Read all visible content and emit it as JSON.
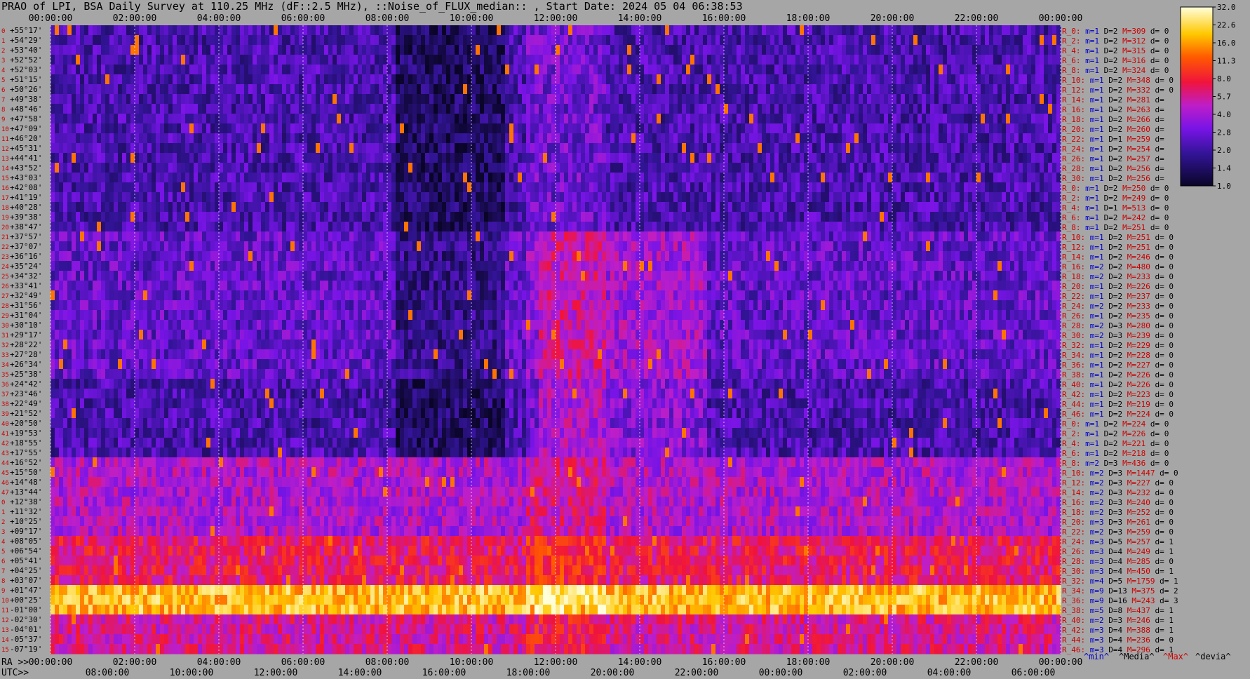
{
  "title": "PRAO of LPI, BSA Daily Survey at 110.25 MHz (dF::2.5 MHz), ::Noise_of_FLUX_median:: , Start Date: 2024 05 04 06:38:53",
  "chart_data": {
    "type": "heatmap",
    "title": "PRAO of LPI, BSA Daily Survey at 110.25 MHz (dF::2.5 MHz), ::Noise_of_FLUX_median:: , Start Date: 2024 05 04 06:38:53",
    "x_top_ticks": [
      "00:00:00",
      "02:00:00",
      "04:00:00",
      "06:00:00",
      "08:00:00",
      "10:00:00",
      "12:00:00",
      "14:00:00",
      "16:00:00",
      "18:00:00",
      "20:00:00",
      "22:00:00",
      "00:00:00"
    ],
    "ra_axis_label": "RA >>",
    "ra_ticks": [
      "00:00:00",
      "02:00:00",
      "04:00:00",
      "06:00:00",
      "08:00:00",
      "10:00:00",
      "12:00:00",
      "14:00:00",
      "16:00:00",
      "18:00:00",
      "20:00:00",
      "22:00:00",
      "00:00:00"
    ],
    "utc_axis_label": "UTC>>",
    "utc_ticks": [
      "08:00:00",
      "10:00:00",
      "12:00:00",
      "14:00:00",
      "16:00:00",
      "18:00:00",
      "20:00:00",
      "22:00:00",
      "00:00:00",
      "02:00:00",
      "04:00:00",
      "06:00:00"
    ],
    "declinations": [
      "+55°17'",
      "+54°29'",
      "+53°40'",
      "+52°52'",
      "+52°03'",
      "+51°15'",
      "+50°26'",
      "+49°38'",
      "+48°46'",
      "+47°58'",
      "+47°09'",
      "+46°20'",
      "+45°31'",
      "+44°41'",
      "+43°52'",
      "+43°03'",
      "+42°08'",
      "+41°19'",
      "+40°28'",
      "+39°38'",
      "+38°47'",
      "+37°57'",
      "+37°07'",
      "+36°16'",
      "+35°24'",
      "+34°32'",
      "+33°41'",
      "+32°49'",
      "+31°56'",
      "+31°04'",
      "+30°10'",
      "+29°17'",
      "+28°22'",
      "+27°28'",
      "+26°34'",
      "+25°38'",
      "+24°42'",
      "+23°46'",
      "+22°49'",
      "+21°52'",
      "+20°50'",
      "+19°53'",
      "+18°55'",
      "+17°55'",
      "+16°52'",
      "+15°50'",
      "+14°48'",
      "+13°44'",
      "+12°38'",
      "+11°32'",
      "+10°25'",
      "+09°17'",
      "+08°05'",
      "+06°54'",
      "+05°41'",
      "+04°25'",
      "+03°07'",
      "+01°47'",
      "+00°25'",
      "-01°00'",
      "-02°30'",
      "-04°01'",
      "-05°37'",
      "-07°19'"
    ],
    "row_stats": [
      [
        "R_0:",
        "m=1",
        "D=2",
        "M=309",
        "d= 0"
      ],
      [
        "R_2:",
        "m=1",
        "D=2",
        "M=312",
        "d= 0"
      ],
      [
        "R_4:",
        "m=1",
        "D=2",
        "M=315",
        "d= 0"
      ],
      [
        "R_6:",
        "m=1",
        "D=2",
        "M=316",
        "d= 0"
      ],
      [
        "R_8:",
        "m=1",
        "D=2",
        "M=324",
        "d= 0"
      ],
      [
        "R_10:",
        "m=1",
        "D=2",
        "M=348",
        "d= 0"
      ],
      [
        "R_12:",
        "m=1",
        "D=2",
        "M=332",
        "d= 0"
      ],
      [
        "R_14:",
        "m=1",
        "D=2",
        "M=281",
        "d= "
      ],
      [
        "R_16:",
        "m=1",
        "D=2",
        "M=263",
        "d= "
      ],
      [
        "R_18:",
        "m=1",
        "D=2",
        "M=266",
        "d= "
      ],
      [
        "R_20:",
        "m=1",
        "D=2",
        "M=260",
        "d= "
      ],
      [
        "R_22:",
        "m=1",
        "D=1",
        "M=259",
        "d= "
      ],
      [
        "R_24:",
        "m=1",
        "D=2",
        "M=254",
        "d= "
      ],
      [
        "R_26:",
        "m=1",
        "D=2",
        "M=257",
        "d= "
      ],
      [
        "R_28:",
        "m=1",
        "D=2",
        "M=256",
        "d= "
      ],
      [
        "R_30:",
        "m=1",
        "D=2",
        "M=256",
        "d= "
      ],
      [
        "R_0:",
        "m=1",
        "D=2",
        "M=250",
        "d= 0"
      ],
      [
        "R_2:",
        "m=1",
        "D=2",
        "M=249",
        "d= 0"
      ],
      [
        "R_4:",
        "m=1",
        "D=1",
        "M=513",
        "d= 0"
      ],
      [
        "R_6:",
        "m=1",
        "D=2",
        "M=242",
        "d= 0"
      ],
      [
        "R_8:",
        "m=1",
        "D=2",
        "M=251",
        "d= 0"
      ],
      [
        "R_10:",
        "m=1",
        "D=2",
        "M=251",
        "d= 0"
      ],
      [
        "R_12:",
        "m=1",
        "D=2",
        "M=251",
        "d= 0"
      ],
      [
        "R_14:",
        "m=1",
        "D=2",
        "M=246",
        "d= 0"
      ],
      [
        "R_16:",
        "m=2",
        "D=2",
        "M=480",
        "d= 0"
      ],
      [
        "R_18:",
        "m=2",
        "D=2",
        "M=233",
        "d= 0"
      ],
      [
        "R_20:",
        "m=1",
        "D=2",
        "M=226",
        "d= 0"
      ],
      [
        "R_22:",
        "m=1",
        "D=2",
        "M=237",
        "d= 0"
      ],
      [
        "R_24:",
        "m=2",
        "D=2",
        "M=233",
        "d= 0"
      ],
      [
        "R_26:",
        "m=1",
        "D=2",
        "M=235",
        "d= 0"
      ],
      [
        "R_28:",
        "m=2",
        "D=3",
        "M=280",
        "d= 0"
      ],
      [
        "R_30:",
        "m=2",
        "D=3",
        "M=239",
        "d= 0"
      ],
      [
        "R_32:",
        "m=1",
        "D=2",
        "M=229",
        "d= 0"
      ],
      [
        "R_34:",
        "m=1",
        "D=2",
        "M=228",
        "d= 0"
      ],
      [
        "R_36:",
        "m=1",
        "D=2",
        "M=227",
        "d= 0"
      ],
      [
        "R_38:",
        "m=1",
        "D=2",
        "M=226",
        "d= 0"
      ],
      [
        "R_40:",
        "m=1",
        "D=2",
        "M=226",
        "d= 0"
      ],
      [
        "R_42:",
        "m=1",
        "D=2",
        "M=223",
        "d= 0"
      ],
      [
        "R_44:",
        "m=1",
        "D=2",
        "M=219",
        "d= 0"
      ],
      [
        "R_46:",
        "m=1",
        "D=2",
        "M=224",
        "d= 0"
      ],
      [
        "R_0:",
        "m=1",
        "D=2",
        "M=224",
        "d= 0"
      ],
      [
        "R_2:",
        "m=1",
        "D=2",
        "M=226",
        "d= 0"
      ],
      [
        "R_4:",
        "m=1",
        "D=2",
        "M=221",
        "d= 0"
      ],
      [
        "R_6:",
        "m=1",
        "D=2",
        "M=218",
        "d= 0"
      ],
      [
        "R_8:",
        "m=2",
        "D=3",
        "M=436",
        "d= 0"
      ],
      [
        "R_10:",
        "m=2",
        "D=3",
        "M=1447",
        "d= 0"
      ],
      [
        "R_12:",
        "m=2",
        "D=3",
        "M=227",
        "d= 0"
      ],
      [
        "R_14:",
        "m=2",
        "D=3",
        "M=232",
        "d= 0"
      ],
      [
        "R_16:",
        "m=2",
        "D=3",
        "M=240",
        "d= 0"
      ],
      [
        "R_18:",
        "m=2",
        "D=3",
        "M=252",
        "d= 0"
      ],
      [
        "R_20:",
        "m=3",
        "D=3",
        "M=261",
        "d= 0"
      ],
      [
        "R_22:",
        "m=2",
        "D=3",
        "M=259",
        "d= 0"
      ],
      [
        "R_24:",
        "m=3",
        "D=5",
        "M=257",
        "d= 1"
      ],
      [
        "R_26:",
        "m=3",
        "D=4",
        "M=249",
        "d= 1"
      ],
      [
        "R_28:",
        "m=3",
        "D=4",
        "M=285",
        "d= 0"
      ],
      [
        "R_30:",
        "m=3",
        "D=4",
        "M=450",
        "d= 1"
      ],
      [
        "R_32:",
        "m=4",
        "D=5",
        "M=1759",
        "d= 1"
      ],
      [
        "R_34:",
        "m=9",
        "D=13",
        "M=375",
        "d= 2"
      ],
      [
        "R_36:",
        "m=9",
        "D=16",
        "M=243",
        "d= 3"
      ],
      [
        "R_38:",
        "m=5",
        "D=8",
        "M=437",
        "d= 1"
      ],
      [
        "R_40:",
        "m=2",
        "D=3",
        "M=246",
        "d= 1"
      ],
      [
        "R_42:",
        "m=3",
        "D=4",
        "M=388",
        "d= 1"
      ],
      [
        "R_44:",
        "m=3",
        "D=4",
        "M=236",
        "d= 0"
      ],
      [
        "R_46:",
        "m=3",
        "D=4",
        "M=296",
        "d= 1"
      ]
    ],
    "bottom_legend": {
      "min": "^min^",
      "median": "^Media^",
      "max": "^Max^",
      "dev": "^devia^"
    },
    "colorbar": {
      "ticks": [
        "32.0",
        "22.6",
        "16.0",
        "11.3",
        "8.0",
        "5.7",
        "4.0",
        "2.8",
        "2.0",
        "1.4",
        "1.0"
      ],
      "scale": "log"
    },
    "colors": {
      "background": "#a6a6a6",
      "label_red": "#cc0000",
      "label_blue": "#0000cc",
      "grid": "#ffffff"
    }
  }
}
